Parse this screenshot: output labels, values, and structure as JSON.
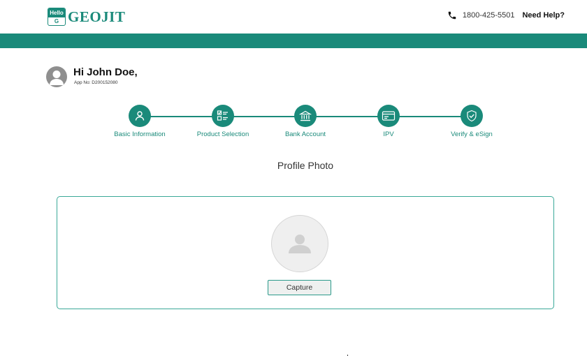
{
  "header": {
    "logo": {
      "badge_top": "Hello",
      "badge_bottom": "G",
      "text": "GEOJIT"
    },
    "phone": "1800-425-5501",
    "help_link": "Need Help?",
    "brand_color": "#1a8a7a"
  },
  "user": {
    "greeting": "Hi John Doe,",
    "app_no": "App No: D200152080"
  },
  "steps": [
    {
      "label": "Basic Information",
      "icon": "user-icon"
    },
    {
      "label": "Product Selection",
      "icon": "checklist-icon"
    },
    {
      "label": "Bank Account",
      "icon": "bank-icon"
    },
    {
      "label": "IPV",
      "icon": "id-card-icon"
    },
    {
      "label": "Verify & eSign",
      "icon": "shield-check-icon"
    }
  ],
  "main": {
    "title": "Profile Photo",
    "capture_label": "Capture"
  }
}
